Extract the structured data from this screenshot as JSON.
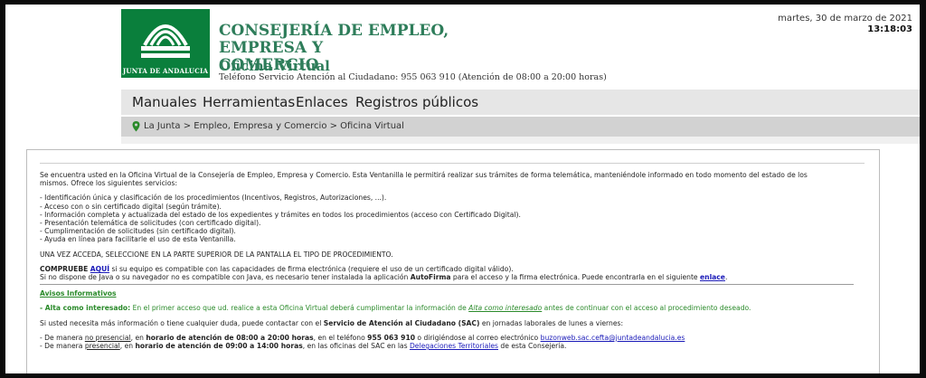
{
  "header": {
    "logo_text": "JUNTA DE ANDALUCIA",
    "title_line1": "CONSEJERÍA DE EMPLEO, EMPRESA Y",
    "title_line2": "COMERCIO",
    "subtitle": "Oficina Virtual",
    "phone": "Teléfono Servicio Atención al Ciudadano: 955 063 910 (Atención de 08:00 a 20:00 horas)",
    "date": "martes, 30 de marzo de 2021",
    "time": "13:18:03"
  },
  "nav": {
    "items": [
      "Manuales",
      "Herramientas",
      "Enlaces",
      "Registros públicos"
    ]
  },
  "breadcrumb": "La Junta > Empleo, Empresa y Comercio > Oficina Virtual",
  "content": {
    "intro1": "Se encuentra usted en la Oficina Virtual de la Consejería de Empleo, Empresa y Comercio. Esta Ventanilla le permitirá realizar sus trámites de forma telemática, manteniéndole informado en todo momento del estado de los",
    "intro2": "mismos. Ofrece los siguientes servicios:",
    "services": [
      "- Identificación única y clasificación de los procedimientos (Incentivos, Registros, Autorizaciones, ...).",
      "- Acceso con o sin certificado digital (según trámite).",
      "- Información completa y actualizada del estado de los expedientes y trámites en todos los procedimientos (acceso con Certificado Digital).",
      "- Presentación telemática de solicitudes (con certificado digital).",
      "- Cumplimentación de solicitudes (sin certificado digital).",
      "- Ayuda en línea para facilitarle el uso de esta Ventanilla."
    ],
    "select_notice": "UNA VEZ ACCEDA, SELECCIONE EN LA PARTE SUPERIOR DE LA PANTALLA EL TIPO DE PROCEDIMIENTO.",
    "comprube_label": "COMPRUEBE",
    "aqui_link": "AQUÍ",
    "comprube_text": " si su equipo es compatible con las capacidades de firma electrónica (requiere el uso de un certificado digital válido).",
    "java_text": "Si no dispone de Java o su navegador no es compatible con Java, es necesario tener instalada la aplicación ",
    "autofirma": "AutoFirma",
    "java_text2": " para el acceso y la firma electrónica. Puede encontrarla en el siguiente ",
    "enlace_link": "enlace",
    "avisos_title": "Avisos Informativos",
    "alta_label": "- Alta como interesado:",
    "alta_text": " En el primer acceso que ud. realice a esta Oficina Virtual deberá cumplimentar la información de ",
    "alta_link": "Alta como interesado",
    "alta_text2": " antes de continuar con el acceso al procedimiento deseado.",
    "sac_text1": "Si usted necesita más información o tiene cualquier duda, puede contactar con el ",
    "sac_bold": "Servicio de Atención al Ciudadano (SAC)",
    "sac_text2": " en jornadas laborales de lunes a viernes:",
    "np_prefix": "- De manera ",
    "np_word": "no presencial",
    "np_mid": ", en ",
    "np_hours": "horario de atención de 08:00 a 20:00 horas",
    "np_text": ", en el teléfono ",
    "np_phone": "955 063 910",
    "np_text2": " o dirigiéndose al correo electrónico ",
    "np_email": "buzonweb.sac.cefta@juntadeandalucia.es",
    "p_prefix": "- De manera ",
    "p_word": "presencial",
    "p_mid": ", en ",
    "p_hours": "horario de atención de 09:00 a 14:00 horas",
    "p_text": ", en las oficinas del SAC en las ",
    "p_link": "Delegaciones Territoriales",
    "p_text2": " de esta Consejería."
  }
}
